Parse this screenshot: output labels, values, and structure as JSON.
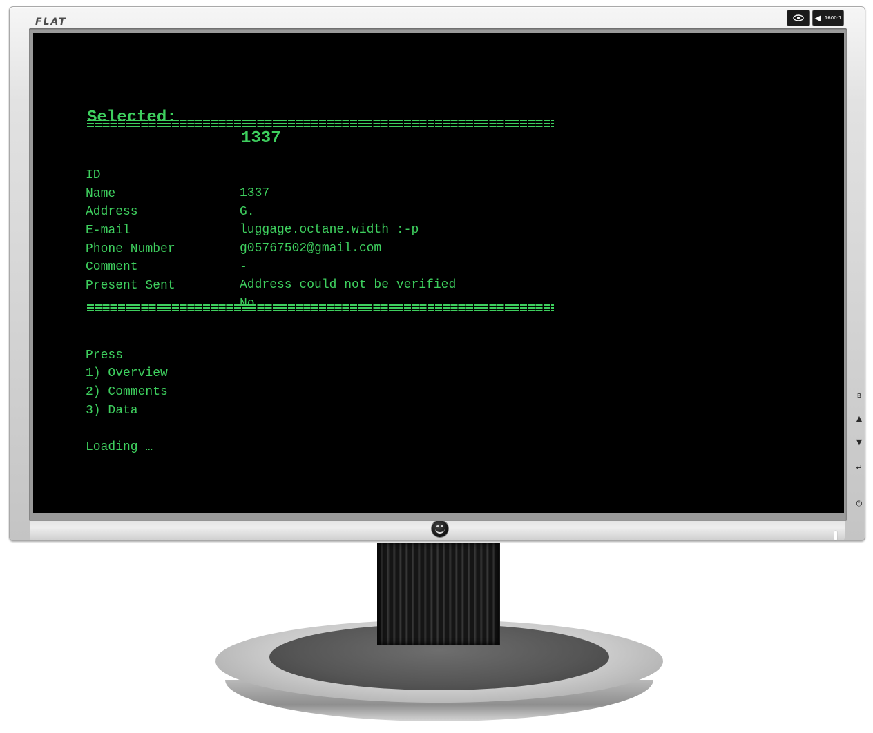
{
  "monitor": {
    "brand": "FLAT",
    "badge_eye_icon": "eye-icon",
    "badge_spec_icon": "speaker-icon",
    "badge_spec_text": "1600:1",
    "side_controls": [
      {
        "icon": "menu-icon",
        "glyph": "ʙ"
      },
      {
        "icon": "up-arrow-icon",
        "glyph": "▲"
      },
      {
        "icon": "down-arrow-icon",
        "glyph": "▼"
      },
      {
        "icon": "enter-icon",
        "glyph": "↵"
      },
      {
        "icon": "power-icon",
        "glyph": "⏻"
      }
    ]
  },
  "terminal": {
    "title_label": "Selected:",
    "title_value": "1337",
    "fields": [
      {
        "key": "ID",
        "value": "1337"
      },
      {
        "key": "Name",
        "value": "G."
      },
      {
        "key": "Address",
        "value": "luggage.octane.width :-p"
      },
      {
        "key": "E-mail",
        "value": "g05767502@gmail.com"
      },
      {
        "key": "Phone Number",
        "value": "-"
      },
      {
        "key": "Comment",
        "value": "Address could not be verified"
      },
      {
        "key": "Present Sent",
        "value": "No"
      }
    ],
    "prompt": "Press",
    "menu": [
      "1) Overview",
      "2) Comments",
      "3) Data"
    ],
    "status": "Loading …"
  },
  "colors": {
    "terminal_text": "#3ecf5e",
    "screen_background": "#000000",
    "bezel": "#d3d3d3"
  }
}
